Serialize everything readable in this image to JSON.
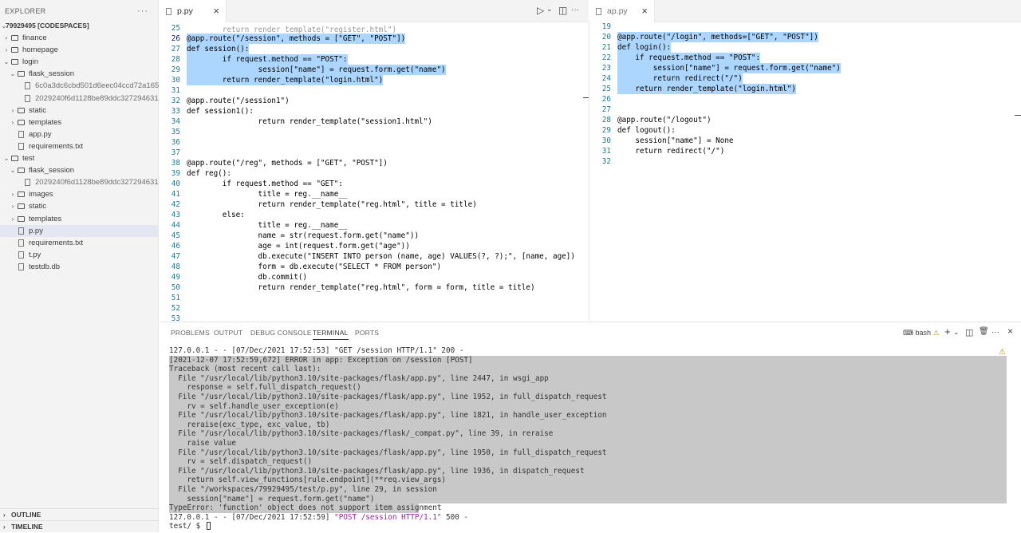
{
  "explorer": {
    "title": "EXPLORER",
    "more": "···",
    "root": "79929495 [CODESPACES]",
    "outline": "OUTLINE",
    "timeline": "TIMELINE",
    "items": [
      {
        "label": "finance",
        "type": "folder",
        "expanded": false
      },
      {
        "label": "homepage",
        "type": "folder",
        "expanded": false
      },
      {
        "label": "login",
        "type": "folder",
        "expanded": true
      },
      {
        "label": "flask_session",
        "type": "folder",
        "expanded": true
      },
      {
        "label": "6c0a3dc6cbd501d6eec04ccd72a165...",
        "type": "file"
      },
      {
        "label": "2029240f6d1128be89ddc327294631...",
        "type": "file"
      },
      {
        "label": "static",
        "type": "folder",
        "expanded": false
      },
      {
        "label": "templates",
        "type": "folder",
        "expanded": false
      },
      {
        "label": "app.py",
        "type": "file"
      },
      {
        "label": "requirements.txt",
        "type": "file"
      },
      {
        "label": "test",
        "type": "folder",
        "expanded": true
      },
      {
        "label": "flask_session",
        "type": "folder",
        "expanded": true
      },
      {
        "label": "2029240f6d1128be89ddc327294631...",
        "type": "file"
      },
      {
        "label": "images",
        "type": "folder",
        "expanded": false
      },
      {
        "label": "static",
        "type": "folder",
        "expanded": false
      },
      {
        "label": "templates",
        "type": "folder",
        "expanded": false
      },
      {
        "label": "p.py",
        "type": "file",
        "selected": true
      },
      {
        "label": "requirements.txt",
        "type": "file"
      },
      {
        "label": "t.py",
        "type": "file"
      },
      {
        "label": "testdb.db",
        "type": "file"
      }
    ]
  },
  "editor_left": {
    "tab": "p.py",
    "close": "×",
    "run": "▷",
    "run_menu": "⌄",
    "split": "◫",
    "more": "···",
    "partial_top": "        return render_template(\"register.html\")",
    "lines": [
      {
        "n": "25",
        "t": ""
      },
      {
        "n": "26",
        "t": "@app.route(\"/session\", methods = [\"GET\", \"POST\"])",
        "sel": true,
        "cur": true
      },
      {
        "n": "27",
        "t": "def session():",
        "sel": true
      },
      {
        "n": "28",
        "t": "        if request.method == \"POST\":",
        "sel": true
      },
      {
        "n": "29",
        "t": "                session[\"name\"] = request.form.get(\"name\")",
        "sel": true
      },
      {
        "n": "30",
        "t": "        return render_template(\"login.html\")",
        "sel": true
      },
      {
        "n": "31",
        "t": ""
      },
      {
        "n": "32",
        "t": "@app.route(\"/session1\")"
      },
      {
        "n": "33",
        "t": "def session1():"
      },
      {
        "n": "34",
        "t": "                return render_template(\"session1.html\")"
      },
      {
        "n": "35",
        "t": ""
      },
      {
        "n": "36",
        "t": ""
      },
      {
        "n": "37",
        "t": ""
      },
      {
        "n": "38",
        "t": "@app.route(\"/reg\", methods = [\"GET\", \"POST\"])"
      },
      {
        "n": "39",
        "t": "def reg():"
      },
      {
        "n": "40",
        "t": "        if request.method == \"GET\":"
      },
      {
        "n": "41",
        "t": "                title = reg.__name__"
      },
      {
        "n": "42",
        "t": "                return render_template(\"reg.html\", title = title)"
      },
      {
        "n": "43",
        "t": "        else:"
      },
      {
        "n": "44",
        "t": "                title = reg.__name__"
      },
      {
        "n": "45",
        "t": "                name = str(request.form.get(\"name\"))"
      },
      {
        "n": "46",
        "t": "                age = int(request.form.get(\"age\"))"
      },
      {
        "n": "47",
        "t": "                db.execute(\"INSERT INTO person (name, age) VALUES(?, ?);\", [name, age])"
      },
      {
        "n": "48",
        "t": "                form = db.execute(\"SELECT * FROM person\")"
      },
      {
        "n": "49",
        "t": "                db.commit()"
      },
      {
        "n": "50",
        "t": "                return render_template(\"reg.html\", form = form, title = title)"
      },
      {
        "n": "51",
        "t": "                "
      },
      {
        "n": "52",
        "t": ""
      },
      {
        "n": "53",
        "t": ""
      }
    ]
  },
  "editor_right": {
    "tab": "ap.py",
    "close": "×",
    "lines": [
      {
        "n": "19",
        "t": ""
      },
      {
        "n": "20",
        "t": "@app.route(\"/login\", methods=[\"GET\", \"POST\"])",
        "sel": true
      },
      {
        "n": "21",
        "t": "def login():",
        "sel": true
      },
      {
        "n": "22",
        "t": "    if request.method == \"POST\":",
        "sel": true
      },
      {
        "n": "23",
        "t": "        session[\"name\"] = request.form.get(\"name\")",
        "sel": true
      },
      {
        "n": "24",
        "t": "        return redirect(\"/\")",
        "sel": true
      },
      {
        "n": "25",
        "t": "    return render_template(\"login.html\")",
        "sel": true
      },
      {
        "n": "26",
        "t": ""
      },
      {
        "n": "27",
        "t": ""
      },
      {
        "n": "28",
        "t": "@app.route(\"/logout\")"
      },
      {
        "n": "29",
        "t": "def logout():"
      },
      {
        "n": "30",
        "t": "    session[\"name\"] = None"
      },
      {
        "n": "31",
        "t": "    return redirect(\"/\")"
      },
      {
        "n": "32",
        "t": ""
      }
    ]
  },
  "panel": {
    "tabs": [
      "PROBLEMS",
      "OUTPUT",
      "DEBUG CONSOLE",
      "TERMINAL",
      "PORTS"
    ],
    "active_tab": "TERMINAL",
    "shell": "bash",
    "warning": "⚠",
    "add": "+",
    "add_menu": "⌄",
    "split": "◫",
    "trash": "🗑",
    "more": "···",
    "maximize": "⌃",
    "close": "×",
    "terminal_lines": [
      {
        "t": "127.0.0.1 - - [07/Dec/2021 17:52:53] \"GET /session HTTP/1.1\" 200 -"
      },
      {
        "t": "[2021-12-07 17:52:59,672] ERROR in app: Exception on /session [POST]",
        "hl": true
      },
      {
        "t": "Traceback (most recent call last):",
        "hl": true
      },
      {
        "t": "  File \"/usr/local/lib/python3.10/site-packages/flask/app.py\", line 2447, in wsgi_app",
        "hl": true
      },
      {
        "t": "    response = self.full_dispatch_request()",
        "hl": true
      },
      {
        "t": "  File \"/usr/local/lib/python3.10/site-packages/flask/app.py\", line 1952, in full_dispatch_request",
        "hl": true
      },
      {
        "t": "    rv = self.handle_user_exception(e)",
        "hl": true
      },
      {
        "t": "  File \"/usr/local/lib/python3.10/site-packages/flask/app.py\", line 1821, in handle_user_exception",
        "hl": true
      },
      {
        "t": "    reraise(exc_type, exc_value, tb)",
        "hl": true
      },
      {
        "t": "  File \"/usr/local/lib/python3.10/site-packages/flask/_compat.py\", line 39, in reraise",
        "hl": true
      },
      {
        "t": "    raise value",
        "hl": true
      },
      {
        "t": "  File \"/usr/local/lib/python3.10/site-packages/flask/app.py\", line 1950, in full_dispatch_request",
        "hl": true
      },
      {
        "t": "    rv = self.dispatch_request()",
        "hl": true
      },
      {
        "t": "  File \"/usr/local/lib/python3.10/site-packages/flask/app.py\", line 1936, in dispatch_request",
        "hl": true
      },
      {
        "t": "    return self.view_functions[rule.endpoint](**req.view_args)",
        "hl": true
      },
      {
        "t": "  File \"/workspaces/79929495/test/p.py\", line 29, in session",
        "hl": true
      },
      {
        "t": "    session[\"name\"] = request.form.get(\"name\")",
        "hl": true
      },
      {
        "t": "TypeError: 'function' object does not support item assignment",
        "hl": true,
        "short": true
      },
      {
        "t": "127.0.0.1 - - [07/Dec/2021 17:52:59] ",
        "m": "\"POST /session HTTP/1.1\"",
        "e": " 500 -"
      },
      {
        "t": "test/ $ ",
        "prompt": true
      }
    ]
  }
}
